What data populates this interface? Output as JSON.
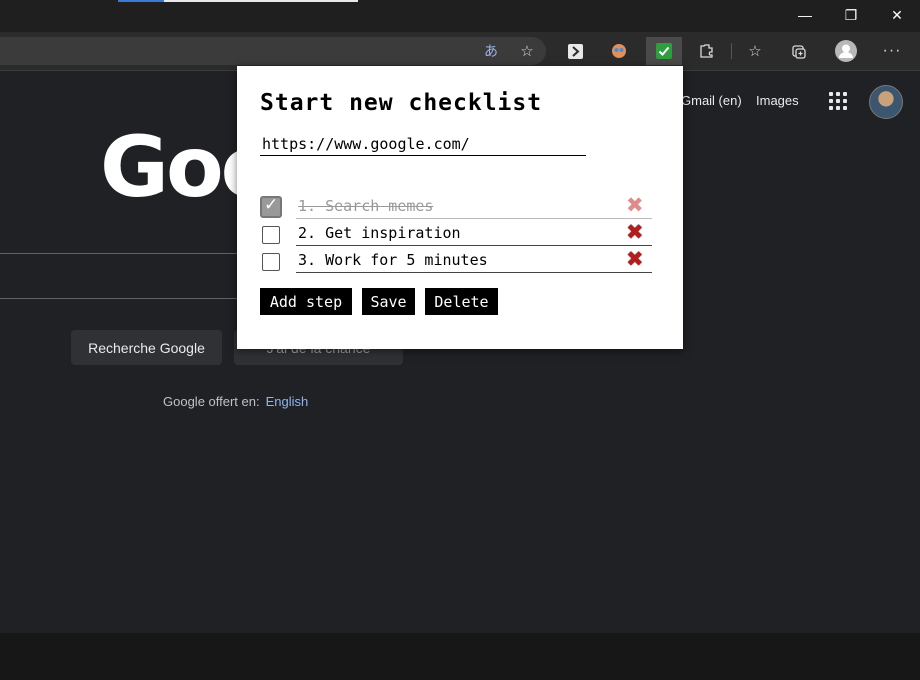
{
  "window": {
    "minimize": "—",
    "restore": "❐",
    "close": "✕"
  },
  "toolbar": {
    "icons": [
      "translate-icon",
      "favorite-add-icon",
      "extension-arrow-icon",
      "extension-face-icon",
      "extension-checklist-icon",
      "extensions-icon",
      "favorites-icon",
      "collections-icon",
      "profile-icon",
      "more-icon"
    ]
  },
  "google": {
    "links": {
      "gmail": "Gmail (en)",
      "images": "Images"
    },
    "logo": "Goo",
    "search_button": "Recherche Google",
    "lucky_button": "J'ai de la chance",
    "offered_label": "Google offert en:",
    "offered_lang": "English"
  },
  "popup": {
    "title": "Start new checklist",
    "url": "https://www.google.com/",
    "steps": [
      {
        "text": "1. Search memes",
        "checked": true
      },
      {
        "text": "2. Get inspiration",
        "checked": false
      },
      {
        "text": "3. Work for 5 minutes",
        "checked": false
      }
    ],
    "buttons": {
      "add": "Add step",
      "save": "Save",
      "delete": "Delete"
    }
  },
  "colors": {
    "delete_x": "#b71c1c",
    "accent_tab": "#3b78d8",
    "link": "#8ab4f8"
  }
}
